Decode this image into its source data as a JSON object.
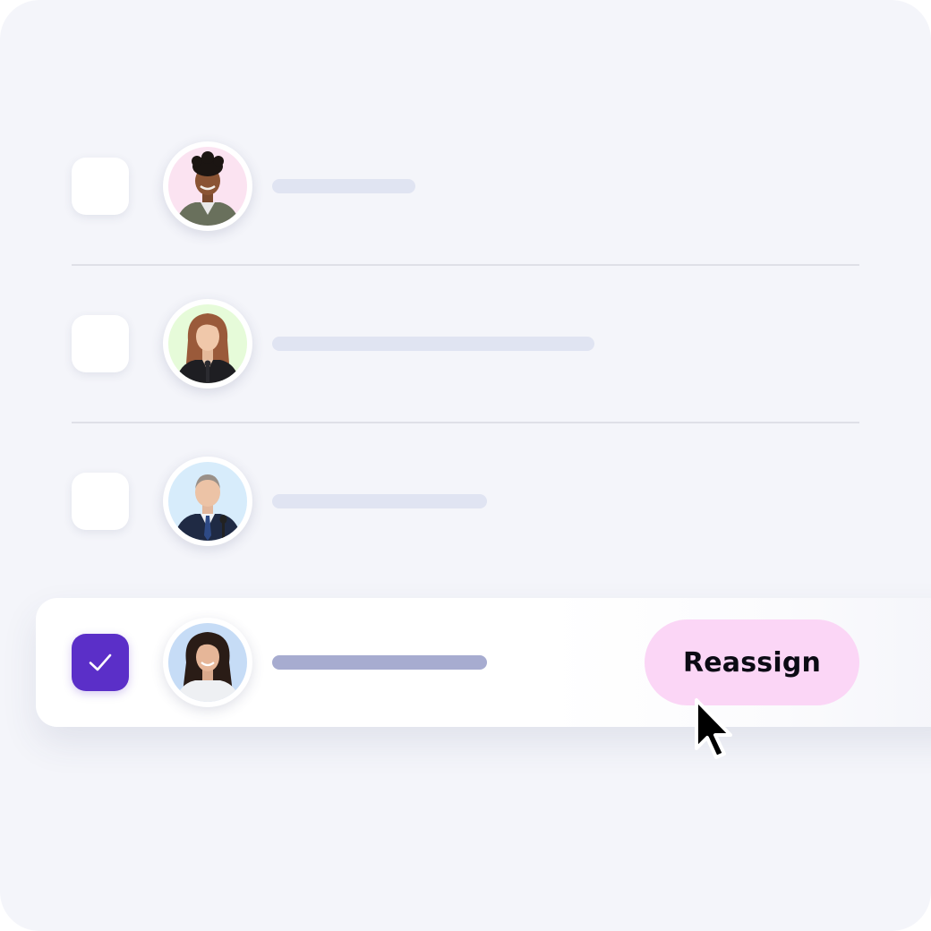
{
  "rows": [
    {
      "avatar": "avatar-man-smiling",
      "checked": false
    },
    {
      "avatar": "avatar-woman-red-hair",
      "checked": false
    },
    {
      "avatar": "avatar-man-in-suit",
      "checked": false
    },
    {
      "avatar": "avatar-woman-dark-hair",
      "checked": true
    }
  ],
  "reassign_button": {
    "label": "Reassign"
  },
  "colors": {
    "background": "#f4f5fa",
    "checkbox_checked": "#5b2fc8",
    "button": "#fbd6f6",
    "placeholder_bar": "#e0e4f2",
    "placeholder_bar_selected": "#a7acd0"
  },
  "icons": [
    "check-icon",
    "mouse-pointer-icon"
  ]
}
